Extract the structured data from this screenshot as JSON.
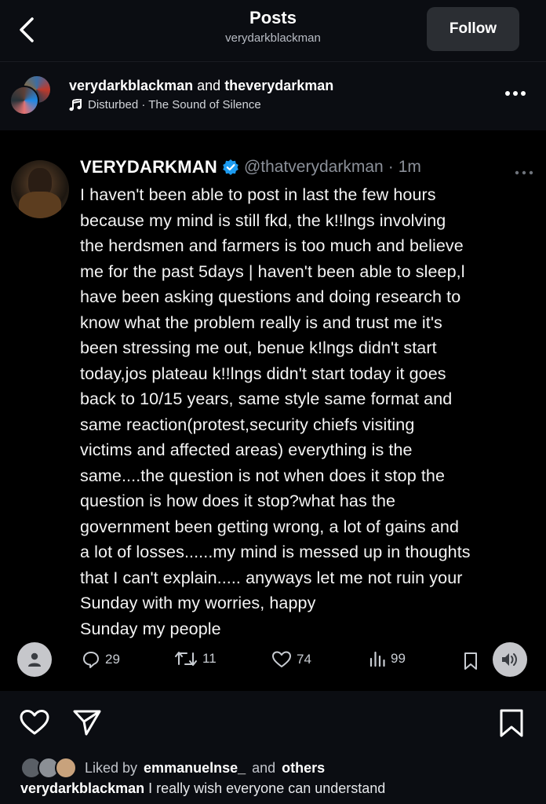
{
  "header": {
    "title": "Posts",
    "subtitle": "verydarkblackman",
    "follow_label": "Follow"
  },
  "author_bar": {
    "user1": "verydarkblackman",
    "and_word": "and",
    "user2": "theverydarkman",
    "music": "Disturbed · The Sound of Silence"
  },
  "tweet": {
    "display_name": "VERYDARKMAN",
    "handle": "@thatverydarkman",
    "separator": "·",
    "time": "1m",
    "body": "I haven't been able to post in last the few hours\nbecause my mind is still fkd, the k!!lngs involving\nthe herdsmen and farmers is too much and believe\nme for the past 5days | haven't been able to sleep,l\nhave been asking questions and doing research to\nknow what the problem really is and trust me it's\nbeen stressing me out, benue k!lngs didn't start\ntoday,jos plateau k!!lngs didn't start today it goes\nback to 10/15 years, same style same format and\nsame reaction(protest,security chiefs visiting\nvictims and affected areas) everything is the\nsame....the question is not when does it stop the\nquestion is how does it stop?what has the\ngovernment been getting wrong, a lot of gains and\na lot of losses......my mind is messed up in thoughts\nthat I can't explain..... anyways let me not ruin your\nSunday with my worries, happy\nSunday my people",
    "replies": "29",
    "retweets": "11",
    "likes": "74",
    "views": "99"
  },
  "footer": {
    "liked_prefix": "Liked by",
    "liked_user": "emmanuelnse_",
    "liked_and": "and",
    "liked_others": "others",
    "caption_user": "verydarkblackman",
    "caption_text": "I really wish everyone can understand"
  },
  "colors": {
    "background": "#0b0d12",
    "card": "#000000",
    "verified": "#1d9bf0",
    "follow_bg": "#2b2e33"
  },
  "icons": [
    "back-arrow-icon",
    "music-note-icon",
    "more-horizontal-icon",
    "verified-badge-icon",
    "reply-icon",
    "retweet-icon",
    "heart-icon",
    "views-icon",
    "bookmark-icon",
    "person-icon",
    "speaker-icon",
    "share-icon",
    "save-icon"
  ]
}
